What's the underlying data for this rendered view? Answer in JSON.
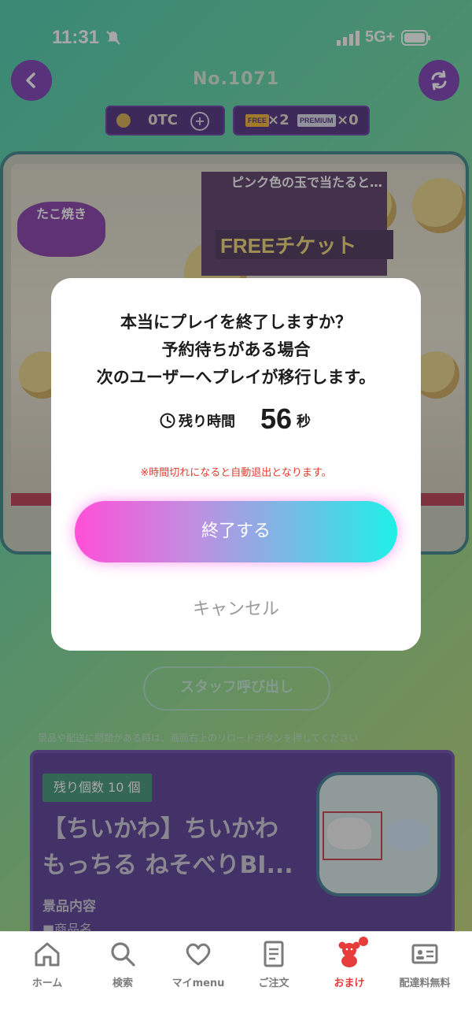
{
  "status_bar": {
    "time": "11:31",
    "network": "5G+"
  },
  "header": {
    "machine_no": "No.1071"
  },
  "wallet": {
    "coins": "0TC",
    "free_tag": "FREE",
    "free_count": "×2",
    "premium_tag": "PREMIUM",
    "premium_count": "×0"
  },
  "stage": {
    "poster_title": "ピンク色の玉で当たると…",
    "poster_free": "FREEチケット",
    "logo_text": "たこ焼き"
  },
  "staff_call_label": "スタッフ呼び出し",
  "notice": "景品や配送に問題がある時は、画面右上のリロードボタンを押してください",
  "prize": {
    "stock": "残り個数 10 個",
    "title": "【ちいかわ】ちいかわ もっちる ねそべりBI...",
    "subhead": "景品内容",
    "item": "■商品名"
  },
  "dialog": {
    "question": "本当にプレイを終了しますか？",
    "line2": "予約待ちがある場合",
    "line3": "次のユーザーへプレイが移行します。",
    "remain_label": "残り時間",
    "remain_seconds": "56",
    "remain_unit": "秒",
    "warning": "※時間切れになると自動退出となります。",
    "end_button": "終了する",
    "cancel_button": "キャンセル"
  },
  "tabs": [
    {
      "label": "ホーム",
      "icon": "home-icon"
    },
    {
      "label": "検索",
      "icon": "search-icon"
    },
    {
      "label": "マイmenu",
      "icon": "heart-icon"
    },
    {
      "label": "ご注文",
      "icon": "order-document-icon"
    },
    {
      "label": "おまけ",
      "icon": "bear-icon",
      "active": true
    },
    {
      "label": "配達料無料",
      "icon": "id-card-icon"
    }
  ],
  "colors": {
    "accent_purple": "#6f2ab0",
    "active_tab": "#e73c3c",
    "warning_red": "#e03c2e",
    "button_gradient_start": "#ff4fd8",
    "button_gradient_end": "#1ff0e6"
  }
}
